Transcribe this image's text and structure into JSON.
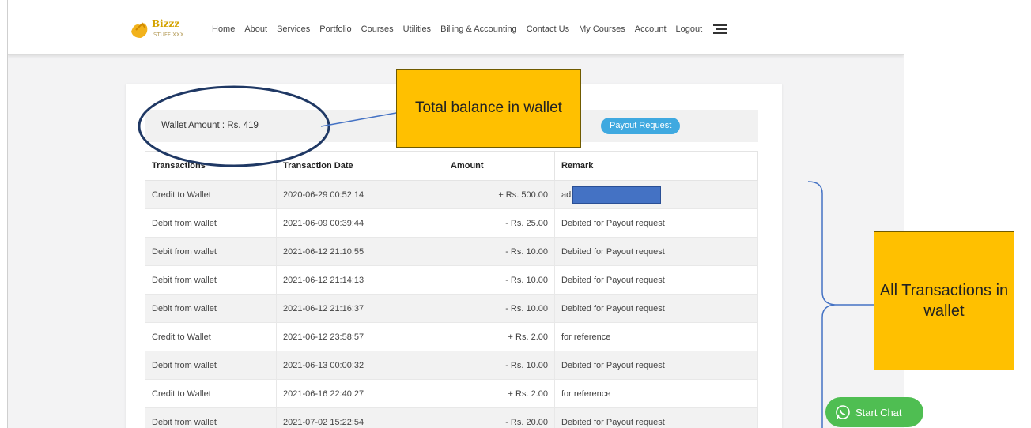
{
  "nav": {
    "logo_text": "Bizzz",
    "items": [
      "Home",
      "About",
      "Services",
      "Portfolio",
      "Courses",
      "Utilities",
      "Billing & Accounting",
      "Contact Us",
      "My Courses",
      "Account",
      "Logout"
    ]
  },
  "wallet": {
    "amount_label": "Wallet Amount : Rs. 419",
    "payout_button": "Payout Request"
  },
  "table": {
    "headers": [
      "Transactions",
      "Transaction Date",
      "Amount",
      "Remark"
    ],
    "rows": [
      [
        "Credit to Wallet",
        "2020-06-29 00:52:14",
        "+ Rs. 500.00",
        "ad"
      ],
      [
        "Debit from wallet",
        "2021-06-09 00:39:44",
        "- Rs. 25.00",
        "Debited for Payout request"
      ],
      [
        "Debit from wallet",
        "2021-06-12 21:10:55",
        "- Rs. 10.00",
        "Debited for Payout request"
      ],
      [
        "Debit from wallet",
        "2021-06-12 21:14:13",
        "- Rs. 10.00",
        "Debited for Payout request"
      ],
      [
        "Debit from wallet",
        "2021-06-12 21:16:37",
        "- Rs. 10.00",
        "Debited for Payout request"
      ],
      [
        "Credit to Wallet",
        "2021-06-12 23:58:57",
        "+ Rs. 2.00",
        "for reference"
      ],
      [
        "Debit from wallet",
        "2021-06-13 00:00:32",
        "- Rs. 10.00",
        "Debited for Payout request"
      ],
      [
        "Credit to Wallet",
        "2021-06-16 22:40:27",
        "+ Rs. 2.00",
        "for reference"
      ],
      [
        "Debit from wallet",
        "2021-07-02 15:22:54",
        "- Rs. 20.00",
        "Debited for Payout request"
      ]
    ]
  },
  "chat": {
    "label": "Start Chat"
  },
  "annotations": {
    "balance_callout": "Total balance in wallet",
    "transactions_callout": "All Transactions in wallet",
    "colors": {
      "callout_fill": "#ffc000",
      "line": "#4472c4",
      "redaction": "#4472c4"
    }
  }
}
